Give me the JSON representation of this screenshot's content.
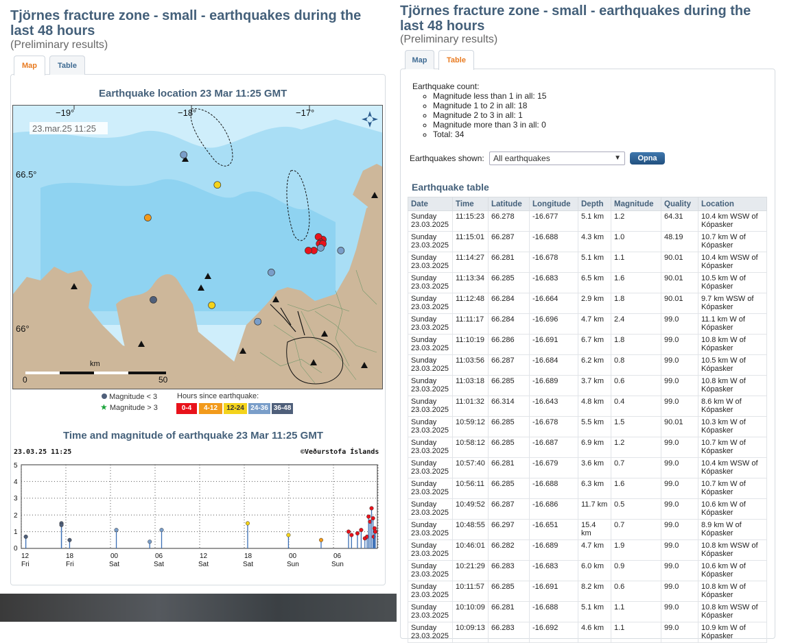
{
  "page": {
    "title": "Tjörnes fracture zone - small - earthquakes during the last 48 hours",
    "subtitle": "(Preliminary results)",
    "tabs": {
      "map": "Map",
      "table": "Table"
    }
  },
  "map_panel": {
    "location_title": "Earthquake location   23 Mar 11:25 GMT",
    "map": {
      "timestamp": "23.mar.25  11:25",
      "lon_labels": [
        "−19°",
        "−18°",
        "−17°"
      ],
      "lat_labels": [
        "66.5°",
        "66°"
      ],
      "scale_unit": "km",
      "scale_start": "0",
      "scale_end": "50",
      "compass_icon": "compass-icon"
    },
    "legend": {
      "mag_small": "Magnitude < 3",
      "mag_large": "Magnitude > 3",
      "hours_title": "Hours since earthquake:",
      "hours": [
        {
          "label": "0-4",
          "color": "#e8121b"
        },
        {
          "label": "4-12",
          "color": "#f29a1b"
        },
        {
          "label": "12-24",
          "color": "#f4d31b"
        },
        {
          "label": "24-36",
          "color": "#7a9ec9"
        },
        {
          "label": "36-48",
          "color": "#4f5f7a"
        }
      ]
    },
    "time_title": "Time and magnitude of earthquake   23 Mar 11:25 GMT",
    "time_chart": {
      "stamp": "23.03.25 11:25",
      "credit": "©Veðurstofa Íslands",
      "ylim": [
        0,
        5
      ],
      "y_ticks": [
        "0",
        "1",
        "2",
        "3",
        "4",
        "5"
      ],
      "x_ticks": [
        {
          "hour": "12",
          "day": "Fri"
        },
        {
          "hour": "18",
          "day": "Fri"
        },
        {
          "hour": "00",
          "day": "Sat"
        },
        {
          "hour": "06",
          "day": "Sat"
        },
        {
          "hour": "12",
          "day": "Sat"
        },
        {
          "hour": "18",
          "day": "Sat"
        },
        {
          "hour": "00",
          "day": "Sun"
        },
        {
          "hour": "06",
          "day": "Sun"
        }
      ]
    }
  },
  "chart_data": {
    "type": "scatter",
    "title": "Time and magnitude of earthquake 23 Mar 11:25 GMT",
    "x_unit": "hours before 23.03.25 11:25",
    "ylim": [
      0,
      5
    ],
    "grid": true,
    "points": [
      {
        "h": 47.2,
        "m": 0.7,
        "c": "#4f5f7a"
      },
      {
        "h": 42.4,
        "m": 1.5,
        "c": "#4f5f7a"
      },
      {
        "h": 42.4,
        "m": 1.4,
        "c": "#4f5f7a"
      },
      {
        "h": 41.3,
        "m": 0.5,
        "c": "#4f5f7a"
      },
      {
        "h": 35.0,
        "m": 1.1,
        "c": "#7a9ec9"
      },
      {
        "h": 30.5,
        "m": 0.4,
        "c": "#7a9ec9"
      },
      {
        "h": 28.9,
        "m": 1.1,
        "c": "#7a9ec9"
      },
      {
        "h": 17.3,
        "m": 1.5,
        "c": "#f4d31b"
      },
      {
        "h": 11.8,
        "m": 0.8,
        "c": "#f4d31b"
      },
      {
        "h": 7.4,
        "m": 0.5,
        "c": "#f29a1b"
      },
      {
        "h": 3.7,
        "m": 1.0,
        "c": "#e8121b"
      },
      {
        "h": 3.3,
        "m": 0.8,
        "c": "#e8121b"
      },
      {
        "h": 2.5,
        "m": 0.9,
        "c": "#e8121b"
      },
      {
        "h": 2.0,
        "m": 1.1,
        "c": "#e8121b"
      },
      {
        "h": 1.5,
        "m": 0.6,
        "c": "#e8121b"
      },
      {
        "h": 1.2,
        "m": 0.7,
        "c": "#e8121b"
      },
      {
        "h": 1.0,
        "m": 1.9,
        "c": "#e8121b"
      },
      {
        "h": 0.8,
        "m": 1.6,
        "c": "#e8121b"
      },
      {
        "h": 0.6,
        "m": 2.4,
        "c": "#e8121b"
      },
      {
        "h": 0.4,
        "m": 1.8,
        "c": "#e8121b"
      },
      {
        "h": 0.3,
        "m": 0.7,
        "c": "#e8121b"
      },
      {
        "h": 0.2,
        "m": 1.2,
        "c": "#e8121b"
      },
      {
        "h": 0.1,
        "m": 1.0,
        "c": "#e8121b"
      }
    ]
  },
  "map_quakes": [
    {
      "lon": -17.88,
      "lat": 66.68,
      "c": "#7a9ec9"
    },
    {
      "lon": -17.58,
      "lat": 66.57,
      "c": "#f4d31b"
    },
    {
      "lon": -18.2,
      "lat": 66.45,
      "c": "#f29a1b"
    },
    {
      "lon": -18.15,
      "lat": 66.15,
      "c": "#4f5f7a"
    },
    {
      "lon": -17.63,
      "lat": 66.13,
      "c": "#f4d31b"
    },
    {
      "lon": -17.1,
      "lat": 66.25,
      "c": "#7a9ec9"
    },
    {
      "lon": -16.64,
      "lat": 66.37,
      "c": "#e8121b"
    },
    {
      "lon": -16.68,
      "lat": 66.38,
      "c": "#e8121b"
    },
    {
      "lon": -16.66,
      "lat": 66.36,
      "c": "#e8121b"
    },
    {
      "lon": -16.67,
      "lat": 66.355,
      "c": "#e8121b"
    },
    {
      "lon": -16.64,
      "lat": 66.355,
      "c": "#e8121b"
    },
    {
      "lon": -16.72,
      "lat": 66.33,
      "c": "#e8121b"
    },
    {
      "lon": -16.77,
      "lat": 66.33,
      "c": "#e8121b"
    },
    {
      "lon": -16.66,
      "lat": 66.34,
      "c": "#7a9ec9"
    },
    {
      "lon": -16.48,
      "lat": 66.33,
      "c": "#7a9ec9"
    },
    {
      "lon": -17.22,
      "lat": 66.07,
      "c": "#7a9ec9"
    }
  ],
  "table_panel": {
    "count_label": "Earthquake count:",
    "counts": [
      "Magnitude less than 1 in all:  15",
      "Magnitude 1 to 2 in all:  18",
      "Magnitude 2 to 3 in all:  1",
      "Magnitude more than 3 in all:  0",
      "Total: 34"
    ],
    "shown_label": "Earthquakes shown:",
    "shown_value": "All earthquakes",
    "open_button": "Opna",
    "table_title": "Earthquake table",
    "columns": [
      "Date",
      "Time",
      "Latitude",
      "Longitude",
      "Depth",
      "Magnitude",
      "Quality",
      "Location"
    ],
    "rows": [
      [
        "Sunday 23.03.2025",
        "11:15:23",
        "66.278",
        "-16.677",
        "5.1 km",
        "1.2",
        "64.31",
        "10.4 km WSW of Kópasker"
      ],
      [
        "Sunday 23.03.2025",
        "11:15:01",
        "66.287",
        "-16.688",
        "4.3 km",
        "1.0",
        "48.19",
        "10.7 km W of Kópasker"
      ],
      [
        "Sunday 23.03.2025",
        "11:14:27",
        "66.281",
        "-16.678",
        "5.1 km",
        "1.1",
        "90.01",
        "10.4 km WSW of Kópasker"
      ],
      [
        "Sunday 23.03.2025",
        "11:13:34",
        "66.285",
        "-16.683",
        "6.5 km",
        "1.6",
        "90.01",
        "10.5 km W of Kópasker"
      ],
      [
        "Sunday 23.03.2025",
        "11:12:48",
        "66.284",
        "-16.664",
        "2.9 km",
        "1.8",
        "90.01",
        "9.7 km WSW of Kópasker"
      ],
      [
        "Sunday 23.03.2025",
        "11:11:17",
        "66.284",
        "-16.696",
        "4.7 km",
        "2.4",
        "99.0",
        "11.1 km W of Kópasker"
      ],
      [
        "Sunday 23.03.2025",
        "11:10:19",
        "66.286",
        "-16.691",
        "6.7 km",
        "1.8",
        "99.0",
        "10.8 km W of Kópasker"
      ],
      [
        "Sunday 23.03.2025",
        "11:03:56",
        "66.287",
        "-16.684",
        "6.2 km",
        "0.8",
        "99.0",
        "10.5 km W of Kópasker"
      ],
      [
        "Sunday 23.03.2025",
        "11:03:18",
        "66.285",
        "-16.689",
        "3.7 km",
        "0.6",
        "99.0",
        "10.8 km W of Kópasker"
      ],
      [
        "Sunday 23.03.2025",
        "11:01:32",
        "66.314",
        "-16.643",
        "4.8 km",
        "0.4",
        "99.0",
        "8.6 km W of Kópasker"
      ],
      [
        "Sunday 23.03.2025",
        "10:59:12",
        "66.285",
        "-16.678",
        "5.5 km",
        "1.5",
        "90.01",
        "10.3 km W of Kópasker"
      ],
      [
        "Sunday 23.03.2025",
        "10:58:12",
        "66.285",
        "-16.687",
        "6.9 km",
        "1.2",
        "99.0",
        "10.7 km W of Kópasker"
      ],
      [
        "Sunday 23.03.2025",
        "10:57:40",
        "66.281",
        "-16.679",
        "3.6 km",
        "0.7",
        "99.0",
        "10.4 km WSW of Kópasker"
      ],
      [
        "Sunday 23.03.2025",
        "10:56:11",
        "66.285",
        "-16.688",
        "6.3 km",
        "1.6",
        "99.0",
        "10.7 km W of Kópasker"
      ],
      [
        "Sunday 23.03.2025",
        "10:49:52",
        "66.287",
        "-16.686",
        "11.7 km",
        "0.5",
        "99.0",
        "10.6 km W of Kópasker"
      ],
      [
        "Sunday 23.03.2025",
        "10:48:55",
        "66.297",
        "-16.651",
        "15.4 km",
        "0.7",
        "99.0",
        "8.9 km W of Kópasker"
      ],
      [
        "Sunday 23.03.2025",
        "10:46:01",
        "66.282",
        "-16.689",
        "4.7 km",
        "1.9",
        "99.0",
        "10.8 km WSW of Kópasker"
      ],
      [
        "Sunday 23.03.2025",
        "10:21:29",
        "66.283",
        "-16.683",
        "6.0 km",
        "0.9",
        "99.0",
        "10.6 km W of Kópasker"
      ],
      [
        "Sunday 23.03.2025",
        "10:11:57",
        "66.285",
        "-16.691",
        "8.2 km",
        "0.6",
        "99.0",
        "10.8 km W of Kópasker"
      ],
      [
        "Sunday 23.03.2025",
        "10:10:09",
        "66.281",
        "-16.688",
        "5.1 km",
        "1.1",
        "99.0",
        "10.8 km WSW of Kópasker"
      ],
      [
        "Sunday 23.03.2025",
        "10:09:13",
        "66.283",
        "-16.692",
        "4.6 km",
        "1.1",
        "99.0",
        "10.9 km W of Kópasker"
      ]
    ]
  }
}
